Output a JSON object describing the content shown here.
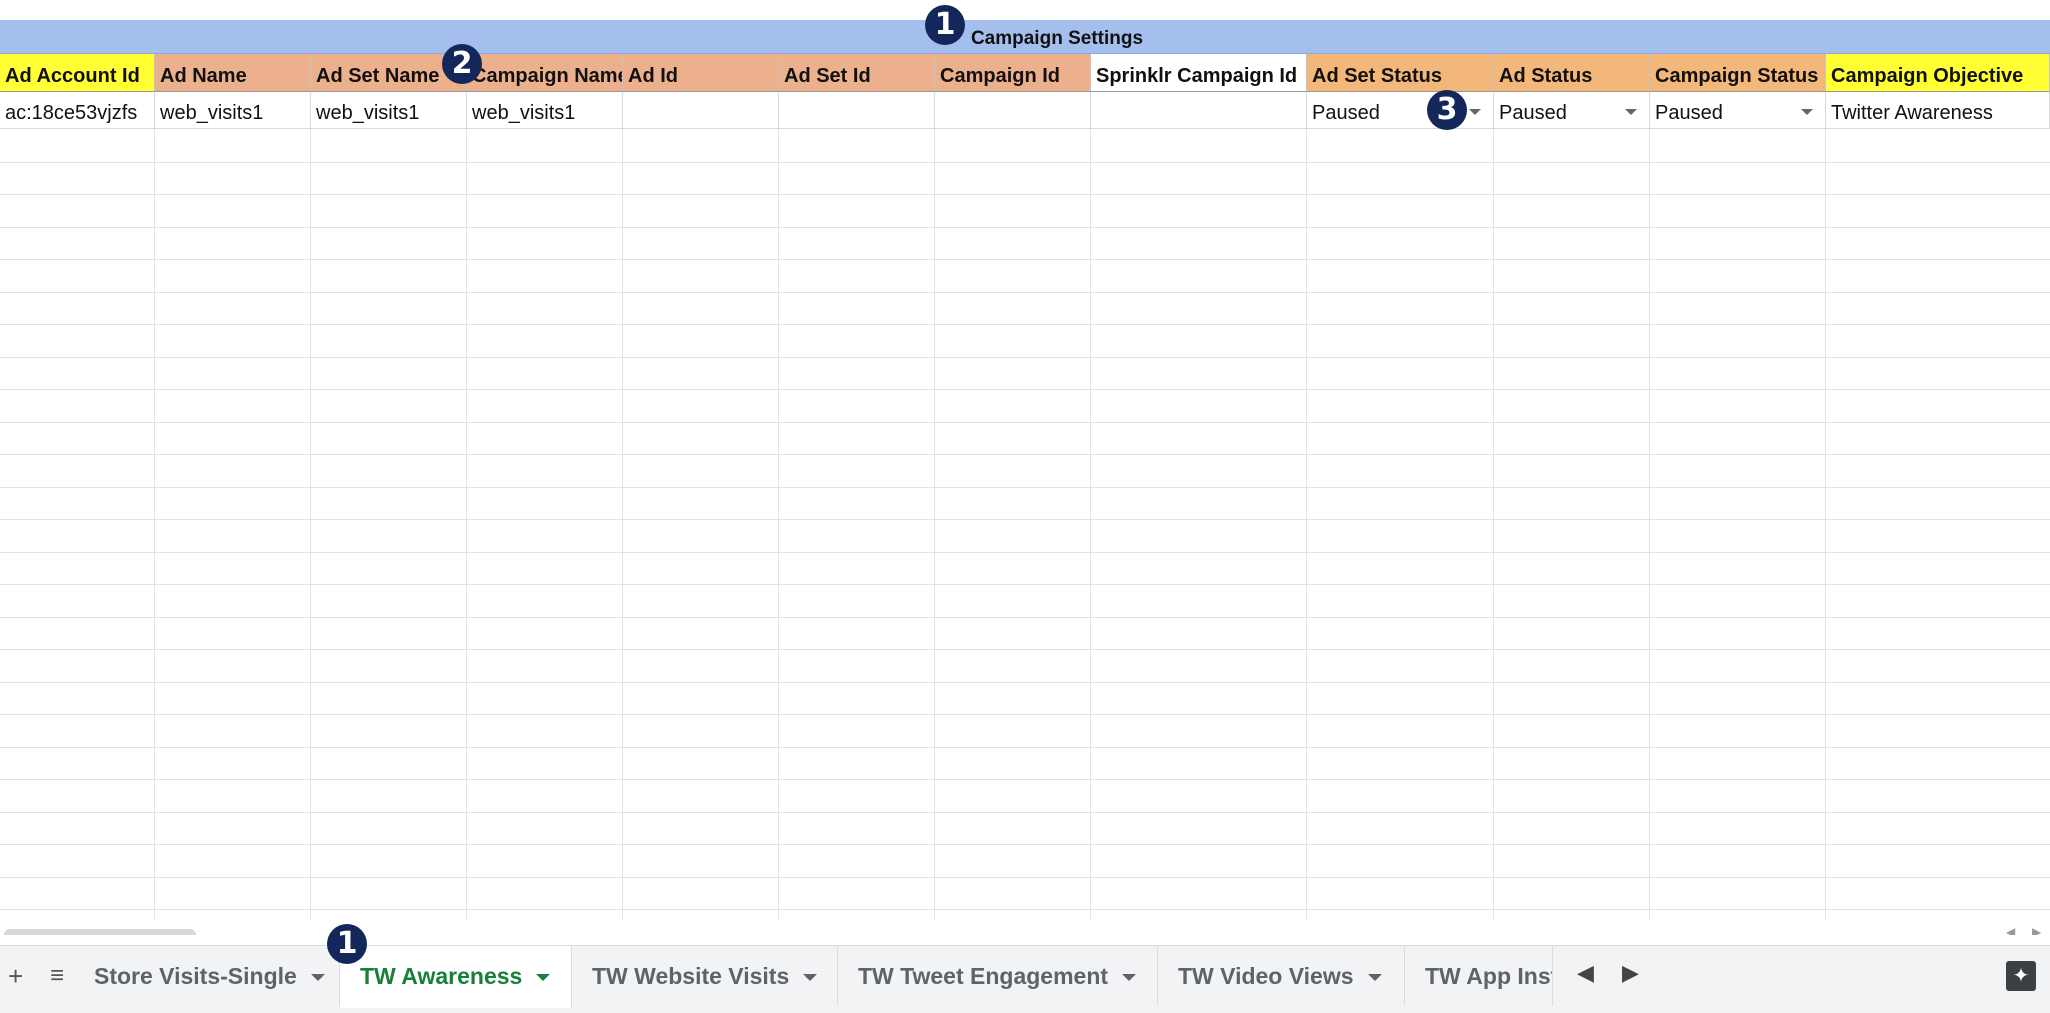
{
  "banner": {
    "title": "Campaign Settings"
  },
  "colors": {
    "banner": "#a4bfee",
    "yellow": "#ffff33",
    "orange": "#ecb18c",
    "orange_status": "#f3b77a",
    "white": "#ffffff",
    "active_tab": "#188038"
  },
  "columns": [
    {
      "label": "Ad Account Id",
      "value": "ac:18ce53vjzfs",
      "color": "#ffff33",
      "dropdown": false
    },
    {
      "label": "Ad Name",
      "value": "web_visits1",
      "color": "#ecb18c",
      "dropdown": false
    },
    {
      "label": "Ad Set Name",
      "value": "web_visits1",
      "color": "#ecb18c",
      "dropdown": false
    },
    {
      "label": "Campaign Name",
      "value": "web_visits1",
      "color": "#ecb18c",
      "dropdown": false
    },
    {
      "label": "Ad Id",
      "value": "",
      "color": "#ecb18c",
      "dropdown": false
    },
    {
      "label": "Ad Set Id",
      "value": "",
      "color": "#ecb18c",
      "dropdown": false
    },
    {
      "label": "Campaign Id",
      "value": "",
      "color": "#ecb18c",
      "dropdown": false
    },
    {
      "label": "Sprinklr Campaign Id",
      "value": "",
      "color": "#ffffff",
      "dropdown": false
    },
    {
      "label": "Ad Set Status",
      "value": "Paused",
      "color": "#f3b77a",
      "dropdown": true
    },
    {
      "label": "Ad Status",
      "value": "Paused",
      "color": "#f3b77a",
      "dropdown": true
    },
    {
      "label": "Campaign Status",
      "value": "Paused",
      "color": "#f3b77a",
      "dropdown": true
    },
    {
      "label": "Campaign Objective",
      "value": "Twitter Awareness",
      "color": "#ffff33",
      "dropdown": false
    }
  ],
  "callouts": [
    "1",
    "2",
    "3",
    "1"
  ],
  "tabs": [
    {
      "label": "Store Visits-Single",
      "active": false
    },
    {
      "label": "TW Awareness",
      "active": true
    },
    {
      "label": "TW Website Visits",
      "active": false
    },
    {
      "label": "TW Tweet Engagement",
      "active": false
    },
    {
      "label": "TW Video Views",
      "active": false
    },
    {
      "label": "TW App Inst",
      "active": false
    }
  ],
  "icons": {
    "add_sheet": "plus-icon",
    "all_sheets": "list-icon",
    "scroll_left": "arrow-left-icon",
    "scroll_right": "arrow-right-icon",
    "explore": "sparkle-icon"
  }
}
